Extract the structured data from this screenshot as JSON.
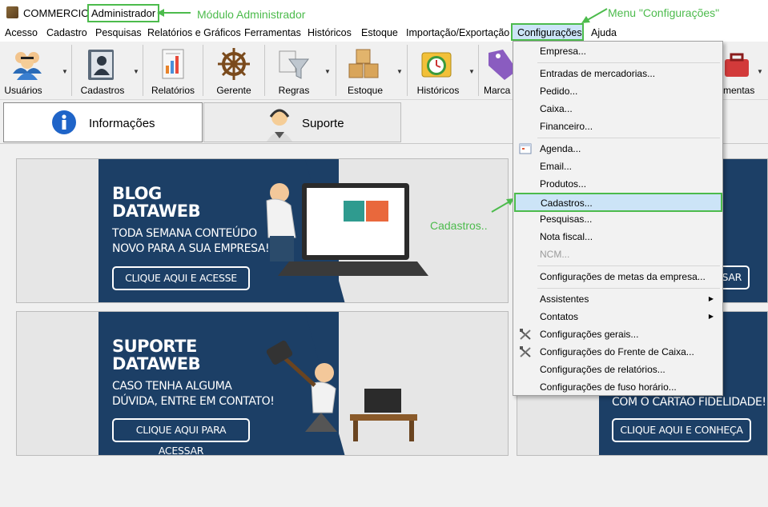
{
  "window": {
    "title": "COMMERCIO - ",
    "module": "Administrador"
  },
  "annotations": {
    "module": "Módulo Administrador",
    "menu": "Menu \"Configurações\"",
    "cadastros": "Cadastros.."
  },
  "menubar": [
    "Acesso",
    "Cadastro",
    "Pesquisas",
    "Relatórios e Gráficos",
    "Ferramentas",
    "Históricos",
    "Estoque",
    "Importação/Exportação",
    "Configurações",
    "Ajuda"
  ],
  "toolbar": {
    "usuarios": "Usuários",
    "cadastros": "Cadastros",
    "relatorios": "Relatórios",
    "gerente": "Gerente",
    "regras": "Regras",
    "estoque": "Estoque",
    "historicos": "Históricos",
    "marcas": "Marca",
    "ferramentas": "mentas"
  },
  "tabs": {
    "informacoes": "Informações",
    "suporte": "Suporte"
  },
  "banners": {
    "blog": {
      "title1": "BLOG",
      "title2": "DATAWEB",
      "sub1": "TODA SEMANA CONTEÚDO",
      "sub2": "NOVO PARA A SUA EMPRESA!",
      "button": "CLIQUE AQUI E ACESSE"
    },
    "suporte": {
      "title1": "SUPORTE",
      "title2": "DATAWEB",
      "sub1": "CASO TENHA ALGUMA",
      "sub2": "DÚVIDA, ENTRE EM CONTATO!",
      "button": "CLIQUE AQUI PARA ACESSAR"
    },
    "right_top": {
      "button": "SAR"
    },
    "right_bottom": {
      "sub": "COM O CARTÃO FIDELIDADE!",
      "button": "CLIQUE AQUI E CONHEÇA"
    }
  },
  "dropdown": {
    "empresa": "Empresa...",
    "entradas": "Entradas de mercadorias...",
    "pedido": "Pedido...",
    "caixa": "Caixa...",
    "financeiro": "Financeiro...",
    "agenda": "Agenda...",
    "email": "Email...",
    "produtos": "Produtos...",
    "cadastros": "Cadastros...",
    "pesquisas": "Pesquisas...",
    "nota_fiscal": "Nota fiscal...",
    "ncm": "NCM...",
    "metas": "Configurações de metas da empresa...",
    "assistentes": "Assistentes",
    "contatos": "Contatos",
    "gerais": "Configurações gerais...",
    "frente_caixa": "Configurações do Frente de Caixa...",
    "relatorios": "Configurações de relatórios...",
    "fuso": "Configurações de fuso horário..."
  },
  "colors": {
    "highlight": "#4cbb4c",
    "menu_hover": "#cce4f7",
    "banner_navy": "#1c3f66"
  }
}
